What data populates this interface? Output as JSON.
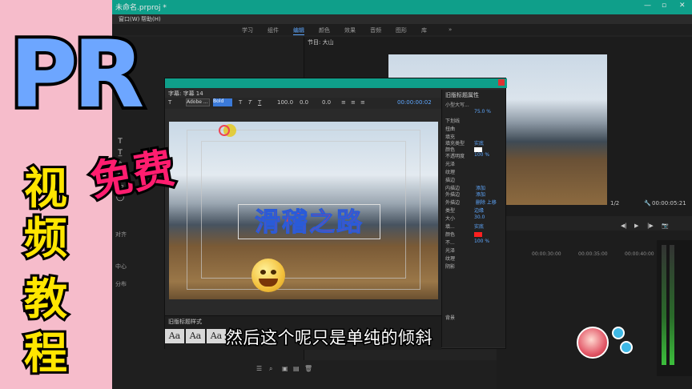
{
  "window": {
    "title": "未命名.prproj *"
  },
  "menu": {
    "items": [
      "窗口(W)",
      "帮助(H)"
    ]
  },
  "workspace": {
    "tabs": [
      "学习",
      "组件",
      "编辑",
      "颜色",
      "效果",
      "音频",
      "图形",
      "库"
    ],
    "active_index": 2,
    "more": "»"
  },
  "program_monitor": {
    "title": "节目: 大山",
    "fit": "1/2",
    "timecode": "00:00:05:21"
  },
  "side_labels": {
    "align": "对齐",
    "center": "中心",
    "distribute": "分布"
  },
  "title_dialog": {
    "tab": "字幕: 字幕 14",
    "font": "Adobe ...",
    "style": "Bold",
    "font_size": "100.0",
    "kerning": "0.0",
    "leading": "0.0",
    "timecode": "00:00:00:02",
    "main_text": "滑稽之路",
    "styles_label": "旧版标题样式",
    "style_sample": "Aa"
  },
  "properties": {
    "title": "旧版标题属性",
    "rows": [
      {
        "label": "小型大写...",
        "value": "75.0 %"
      },
      {
        "label": "下划线",
        "value": ""
      },
      {
        "label": "扭曲",
        "value": ""
      },
      {
        "label": "填充",
        "value": ""
      },
      {
        "label": "填充类型",
        "value": "实底"
      },
      {
        "label": "颜色",
        "value": ""
      },
      {
        "label": "不透明度",
        "value": "100 %"
      },
      {
        "label": "光泽",
        "value": ""
      },
      {
        "label": "纹理",
        "value": ""
      },
      {
        "label": "描边",
        "value": ""
      },
      {
        "label": "内描边",
        "value": "添加"
      },
      {
        "label": "外描边",
        "value": "添加"
      },
      {
        "label": "外描边",
        "value": "删除 上移"
      },
      {
        "label": "类型",
        "value": "边缘"
      },
      {
        "label": "大小",
        "value": "30.0"
      },
      {
        "label": "填...",
        "value": "实底"
      },
      {
        "label": "颜色",
        "value": ""
      },
      {
        "label": "不...",
        "value": "100 %"
      },
      {
        "label": "光泽",
        "value": ""
      },
      {
        "label": "纹理",
        "value": ""
      },
      {
        "label": "阴影",
        "value": ""
      },
      {
        "label": "背景",
        "value": ""
      }
    ],
    "fill_color": "#ffffff",
    "stroke_color": "#ff2020"
  },
  "timeline": {
    "times": [
      "00:00:30:00",
      "00:00:35:00",
      "00:00:40:00"
    ]
  },
  "overlay": {
    "pr": "PR",
    "free": "免费",
    "vertical": [
      "视",
      "频",
      "教",
      "程"
    ],
    "subtitle": "然后这个呢只是单纯的倾斜"
  },
  "colors": {
    "accent_teal": "#0f9f8a",
    "pr_blue": "#6da6ff",
    "free_pink": "#ff1d6f",
    "label_yellow": "#ffe600",
    "title_red": "#ff3a30"
  },
  "icons": [
    "minimize-icon",
    "maximize-icon",
    "close-icon",
    "search-icon",
    "folder-icon",
    "trash-icon",
    "wrench-icon"
  ]
}
